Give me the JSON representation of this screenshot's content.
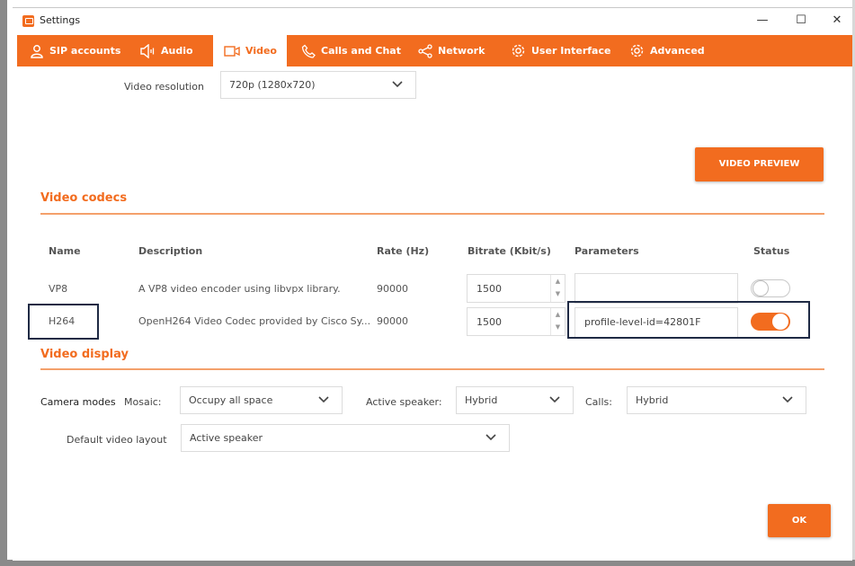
{
  "window": {
    "title": "Settings"
  },
  "window_controls": {
    "minimize": "—",
    "maximize": "☐",
    "close": "✕"
  },
  "tabs": [
    {
      "label": "SIP accounts",
      "icon": "user-icon"
    },
    {
      "label": "Audio",
      "icon": "speaker-icon"
    },
    {
      "label": "Video",
      "icon": "camera-icon",
      "active": true
    },
    {
      "label": "Calls and Chat",
      "icon": "phone-icon"
    },
    {
      "label": "Network",
      "icon": "share-icon"
    },
    {
      "label": "User Interface",
      "icon": "gear-icon"
    },
    {
      "label": "Advanced",
      "icon": "gear-icon"
    }
  ],
  "video": {
    "resolution_label": "Video resolution",
    "resolution_value": "720p (1280x720)",
    "preview_button": "VIDEO PREVIEW"
  },
  "codecs": {
    "title": "Video codecs",
    "columns": [
      "Name",
      "Description",
      "Rate (Hz)",
      "Bitrate (Kbit/s)",
      "Parameters",
      "Status"
    ],
    "rows": [
      {
        "name": "VP8",
        "description": "A VP8 video encoder using libvpx library.",
        "rate": "90000",
        "bitrate": "1500",
        "parameters": "",
        "enabled": false
      },
      {
        "name": "H264",
        "description": "OpenH264 Video Codec provided by Cisco Sy...",
        "rate": "90000",
        "bitrate": "1500",
        "parameters": "profile-level-id=42801F",
        "enabled": true
      }
    ]
  },
  "display": {
    "title": "Video display",
    "camera_modes_label": "Camera modes",
    "mosaic_label": "Mosaic:",
    "mosaic_value": "Occupy all space",
    "active_speaker_label": "Active speaker:",
    "active_speaker_value": "Hybrid",
    "calls_label": "Calls:",
    "calls_value": "Hybrid",
    "default_layout_label": "Default video layout",
    "default_layout_value": "Active speaker"
  },
  "ok_button": "OK",
  "colors": {
    "accent": "#f26c1f",
    "highlight_box": "#1f2a44"
  }
}
